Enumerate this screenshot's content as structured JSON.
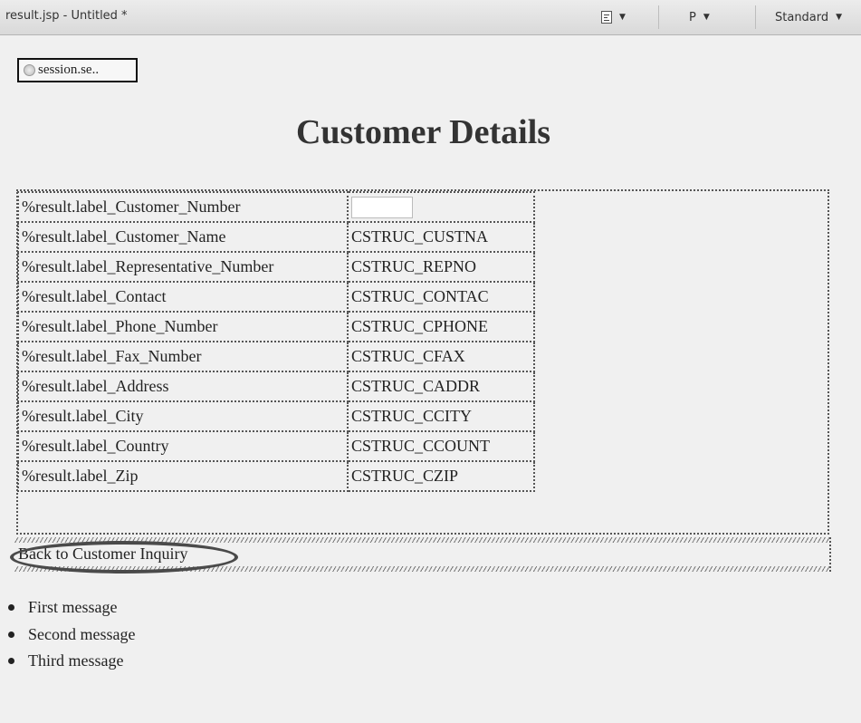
{
  "toolbar": {
    "title": "result.jsp - Untitled *",
    "paragraph_icon": "paragraph-format-icon",
    "style_value": "P",
    "font_value": "Standard"
  },
  "session": {
    "label": "session.se.."
  },
  "page": {
    "title": "Customer Details"
  },
  "details": {
    "rows": [
      {
        "label": "%result.label_Customer_Number",
        "value": ""
      },
      {
        "label": "%result.label_Customer_Name",
        "value": "CSTRUC_CUSTNA"
      },
      {
        "label": "%result.label_Representative_Number",
        "value": "CSTRUC_REPNO"
      },
      {
        "label": "%result.label_Contact",
        "value": "CSTRUC_CONTAC"
      },
      {
        "label": "%result.label_Phone_Number",
        "value": "CSTRUC_CPHONE"
      },
      {
        "label": "%result.label_Fax_Number",
        "value": "CSTRUC_CFAX"
      },
      {
        "label": "%result.label_Address",
        "value": "CSTRUC_CADDR"
      },
      {
        "label": "%result.label_City",
        "value": "CSTRUC_CCITY"
      },
      {
        "label": "%result.label_Country",
        "value": "CSTRUC_CCOUNT"
      },
      {
        "label": "%result.label_Zip",
        "value": "CSTRUC_CZIP"
      }
    ]
  },
  "link": {
    "label": "Back to Customer Inquiry"
  },
  "messages": [
    "First message",
    "Second message",
    "Third message"
  ]
}
